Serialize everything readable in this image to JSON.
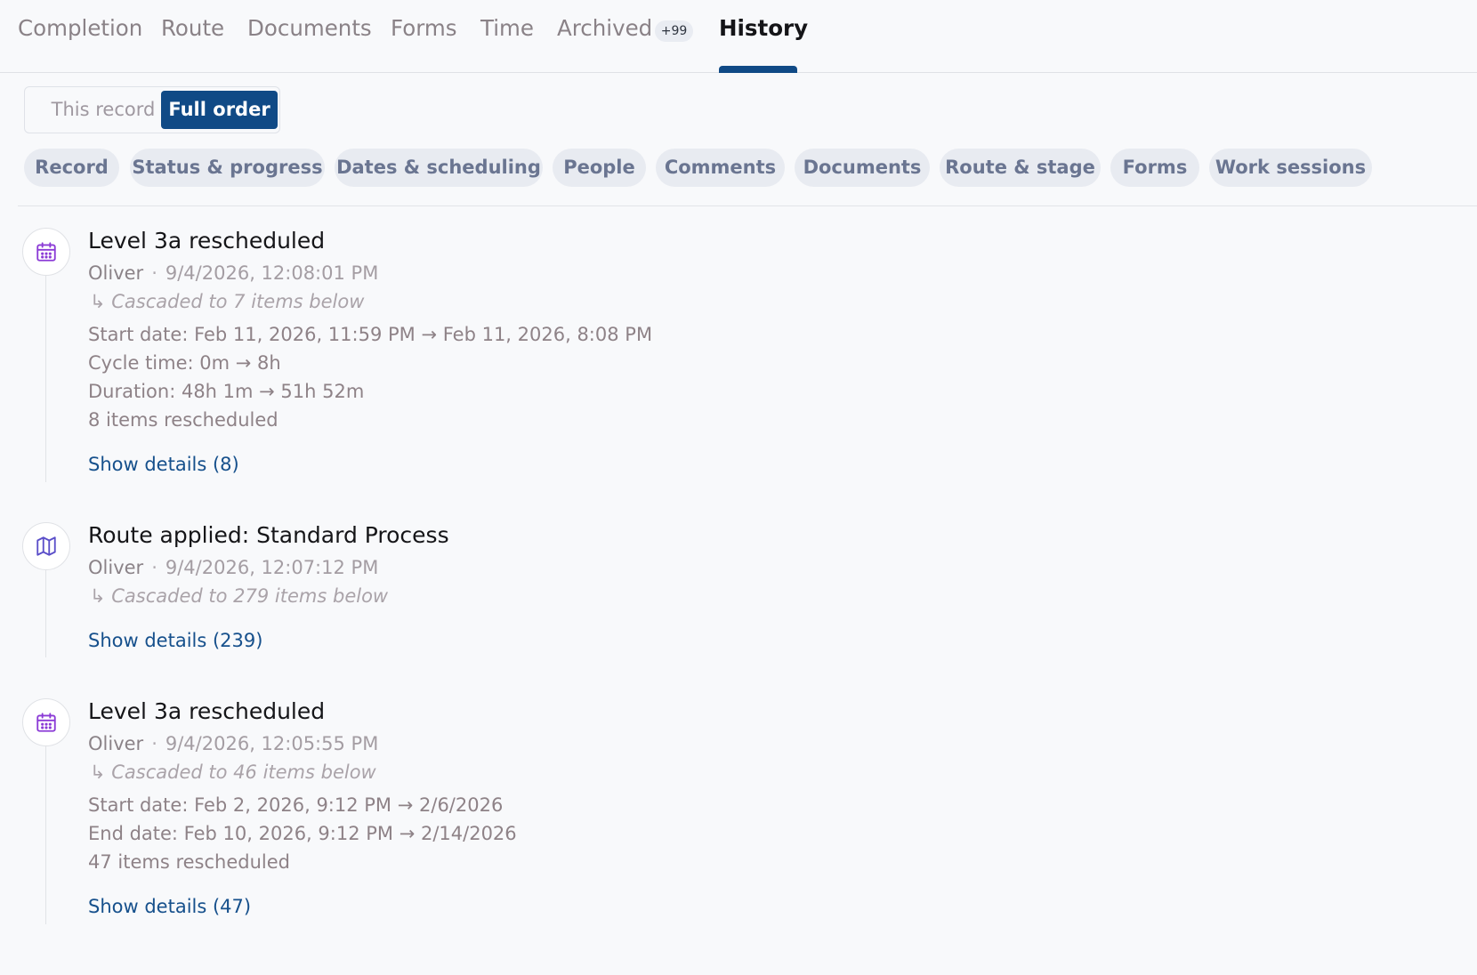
{
  "tabs": {
    "completion": "Completion",
    "route": "Route",
    "documents": "Documents",
    "forms": "Forms",
    "time": "Time",
    "archived": "Archived",
    "archived_count": "+99",
    "history": "History"
  },
  "scope": {
    "this_record": "This record",
    "full_order": "Full order",
    "selected": "Full order"
  },
  "filters": [
    "Record",
    "Status & progress",
    "Dates & scheduling",
    "People",
    "Comments",
    "Documents",
    "Route & stage",
    "Forms",
    "Work sessions"
  ],
  "events": [
    {
      "icon": "calendar-icon",
      "title": "Level 3a rescheduled",
      "author": "Oliver",
      "separator": "·",
      "timestamp": "9/4/2026, 12:08:01 PM",
      "cascade": "↳ Cascaded to 7 items below",
      "lines": [
        "Start date: Feb 11, 2026, 11:59 PM → Feb 11, 2026, 8:08 PM",
        "Cycle time: 0m → 8h",
        "Duration: 48h 1m → 51h 52m",
        "8 items rescheduled"
      ],
      "details": "Show details (8)"
    },
    {
      "icon": "map-icon",
      "title": "Route applied: Standard Process",
      "author": "Oliver",
      "separator": "·",
      "timestamp": "9/4/2026, 12:07:12 PM",
      "cascade": "↳ Cascaded to 279 items below",
      "lines": [],
      "details": "Show details (239)"
    },
    {
      "icon": "calendar-icon",
      "title": "Level 3a rescheduled",
      "author": "Oliver",
      "separator": "·",
      "timestamp": "9/4/2026, 12:05:55 PM",
      "cascade": "↳ Cascaded to 46 items below",
      "lines": [
        "Start date: Feb 2, 2026, 9:12 PM → 2/6/2026",
        "End date: Feb 10, 2026, 9:12 PM → 2/14/2026",
        "47 items rescheduled"
      ],
      "details": "Show details (47)"
    }
  ],
  "colors": {
    "accent": "#104a86",
    "link": "#16508c",
    "icon_purple": "#8b3bd6",
    "chip_bg": "#e8ebf1",
    "chip_text": "#6a7591"
  }
}
